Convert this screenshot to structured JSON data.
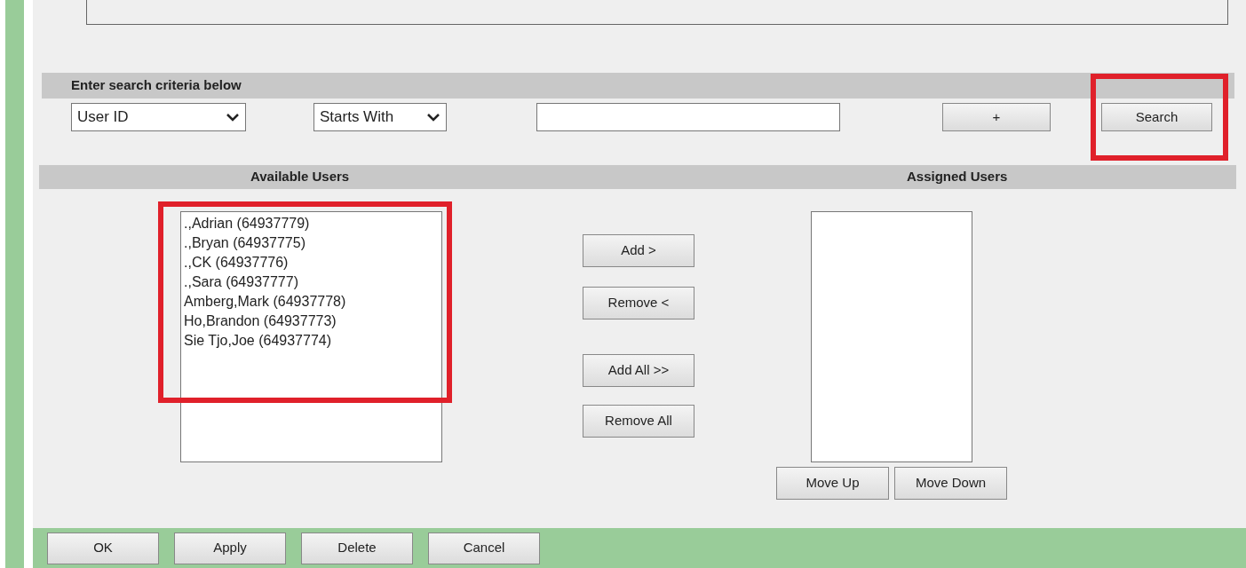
{
  "criteria": {
    "heading": "Enter search criteria below",
    "field_dropdown": "User ID",
    "operator_dropdown": "Starts With",
    "buttons": [
      {
        "label": "+",
        "highlighted": false
      },
      {
        "label": "Search",
        "highlighted": true
      }
    ]
  },
  "available_users": {
    "heading": "Available Users",
    "highlighted": true,
    "items": [
      ".,Adrian (64937779)",
      ".,Bryan (64937775)",
      ".,CK (64937776)",
      ".,Sara (64937777)",
      "Amberg,Mark (64937778)",
      "Ho,Brandon (64937773)",
      "Sie Tjo,Joe (64937774)"
    ]
  },
  "transfer_buttons": [
    "Add >",
    "Remove <",
    "Add All >>",
    "Remove All"
  ],
  "assigned_users": {
    "heading": "Assigned Users",
    "buttons": [
      "Move Up",
      "Move Down"
    ]
  },
  "footer_buttons": [
    "OK",
    "Apply",
    "Delete",
    "Cancel"
  ]
}
